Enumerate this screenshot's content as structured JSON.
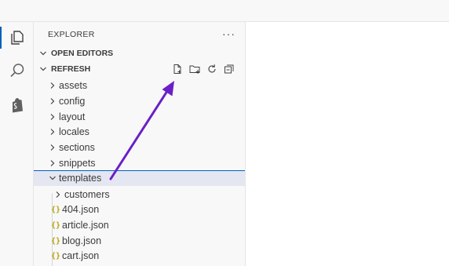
{
  "explorer": {
    "title": "EXPLORER",
    "more_label": "···"
  },
  "sections": {
    "open_editors": "OPEN EDITORS",
    "workspace": "REFRESH"
  },
  "workspace_actions": [
    "new-file-icon",
    "new-folder-icon",
    "refresh-icon",
    "collapse-all-icon"
  ],
  "tree": {
    "folders": [
      "assets",
      "config",
      "layout",
      "locales",
      "sections",
      "snippets"
    ],
    "templates": "templates",
    "templates_children": {
      "folder": "customers",
      "files": [
        "404.json",
        "article.json",
        "blog.json",
        "cart.json"
      ]
    }
  },
  "activity": [
    "explorer-icon",
    "search-icon",
    "shopify-icon"
  ],
  "colors": {
    "accent": "#005fb8",
    "annotation_arrow": "#6a1fc8",
    "json_icon": "#b5a20c"
  }
}
